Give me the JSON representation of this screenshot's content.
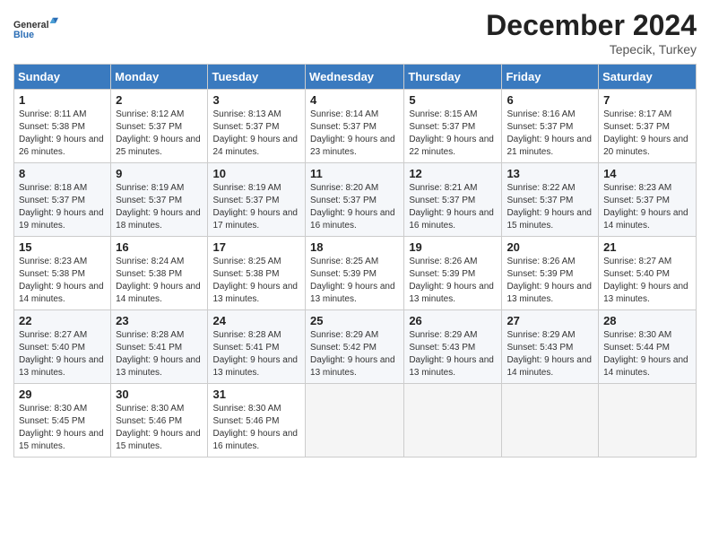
{
  "logo": {
    "general": "General",
    "blue": "Blue"
  },
  "header": {
    "month": "December 2024",
    "location": "Tepecik, Turkey"
  },
  "weekdays": [
    "Sunday",
    "Monday",
    "Tuesday",
    "Wednesday",
    "Thursday",
    "Friday",
    "Saturday"
  ],
  "weeks": [
    [
      {
        "day": "1",
        "sunrise": "8:11 AM",
        "sunset": "5:38 PM",
        "daylight": "9 hours and 26 minutes."
      },
      {
        "day": "2",
        "sunrise": "8:12 AM",
        "sunset": "5:37 PM",
        "daylight": "9 hours and 25 minutes."
      },
      {
        "day": "3",
        "sunrise": "8:13 AM",
        "sunset": "5:37 PM",
        "daylight": "9 hours and 24 minutes."
      },
      {
        "day": "4",
        "sunrise": "8:14 AM",
        "sunset": "5:37 PM",
        "daylight": "9 hours and 23 minutes."
      },
      {
        "day": "5",
        "sunrise": "8:15 AM",
        "sunset": "5:37 PM",
        "daylight": "9 hours and 22 minutes."
      },
      {
        "day": "6",
        "sunrise": "8:16 AM",
        "sunset": "5:37 PM",
        "daylight": "9 hours and 21 minutes."
      },
      {
        "day": "7",
        "sunrise": "8:17 AM",
        "sunset": "5:37 PM",
        "daylight": "9 hours and 20 minutes."
      }
    ],
    [
      {
        "day": "8",
        "sunrise": "8:18 AM",
        "sunset": "5:37 PM",
        "daylight": "9 hours and 19 minutes."
      },
      {
        "day": "9",
        "sunrise": "8:19 AM",
        "sunset": "5:37 PM",
        "daylight": "9 hours and 18 minutes."
      },
      {
        "day": "10",
        "sunrise": "8:19 AM",
        "sunset": "5:37 PM",
        "daylight": "9 hours and 17 minutes."
      },
      {
        "day": "11",
        "sunrise": "8:20 AM",
        "sunset": "5:37 PM",
        "daylight": "9 hours and 16 minutes."
      },
      {
        "day": "12",
        "sunrise": "8:21 AM",
        "sunset": "5:37 PM",
        "daylight": "9 hours and 16 minutes."
      },
      {
        "day": "13",
        "sunrise": "8:22 AM",
        "sunset": "5:37 PM",
        "daylight": "9 hours and 15 minutes."
      },
      {
        "day": "14",
        "sunrise": "8:23 AM",
        "sunset": "5:37 PM",
        "daylight": "9 hours and 14 minutes."
      }
    ],
    [
      {
        "day": "15",
        "sunrise": "8:23 AM",
        "sunset": "5:38 PM",
        "daylight": "9 hours and 14 minutes."
      },
      {
        "day": "16",
        "sunrise": "8:24 AM",
        "sunset": "5:38 PM",
        "daylight": "9 hours and 14 minutes."
      },
      {
        "day": "17",
        "sunrise": "8:25 AM",
        "sunset": "5:38 PM",
        "daylight": "9 hours and 13 minutes."
      },
      {
        "day": "18",
        "sunrise": "8:25 AM",
        "sunset": "5:39 PM",
        "daylight": "9 hours and 13 minutes."
      },
      {
        "day": "19",
        "sunrise": "8:26 AM",
        "sunset": "5:39 PM",
        "daylight": "9 hours and 13 minutes."
      },
      {
        "day": "20",
        "sunrise": "8:26 AM",
        "sunset": "5:39 PM",
        "daylight": "9 hours and 13 minutes."
      },
      {
        "day": "21",
        "sunrise": "8:27 AM",
        "sunset": "5:40 PM",
        "daylight": "9 hours and 13 minutes."
      }
    ],
    [
      {
        "day": "22",
        "sunrise": "8:27 AM",
        "sunset": "5:40 PM",
        "daylight": "9 hours and 13 minutes."
      },
      {
        "day": "23",
        "sunrise": "8:28 AM",
        "sunset": "5:41 PM",
        "daylight": "9 hours and 13 minutes."
      },
      {
        "day": "24",
        "sunrise": "8:28 AM",
        "sunset": "5:41 PM",
        "daylight": "9 hours and 13 minutes."
      },
      {
        "day": "25",
        "sunrise": "8:29 AM",
        "sunset": "5:42 PM",
        "daylight": "9 hours and 13 minutes."
      },
      {
        "day": "26",
        "sunrise": "8:29 AM",
        "sunset": "5:43 PM",
        "daylight": "9 hours and 13 minutes."
      },
      {
        "day": "27",
        "sunrise": "8:29 AM",
        "sunset": "5:43 PM",
        "daylight": "9 hours and 14 minutes."
      },
      {
        "day": "28",
        "sunrise": "8:30 AM",
        "sunset": "5:44 PM",
        "daylight": "9 hours and 14 minutes."
      }
    ],
    [
      {
        "day": "29",
        "sunrise": "8:30 AM",
        "sunset": "5:45 PM",
        "daylight": "9 hours and 15 minutes."
      },
      {
        "day": "30",
        "sunrise": "8:30 AM",
        "sunset": "5:46 PM",
        "daylight": "9 hours and 15 minutes."
      },
      {
        "day": "31",
        "sunrise": "8:30 AM",
        "sunset": "5:46 PM",
        "daylight": "9 hours and 16 minutes."
      },
      null,
      null,
      null,
      null
    ]
  ]
}
